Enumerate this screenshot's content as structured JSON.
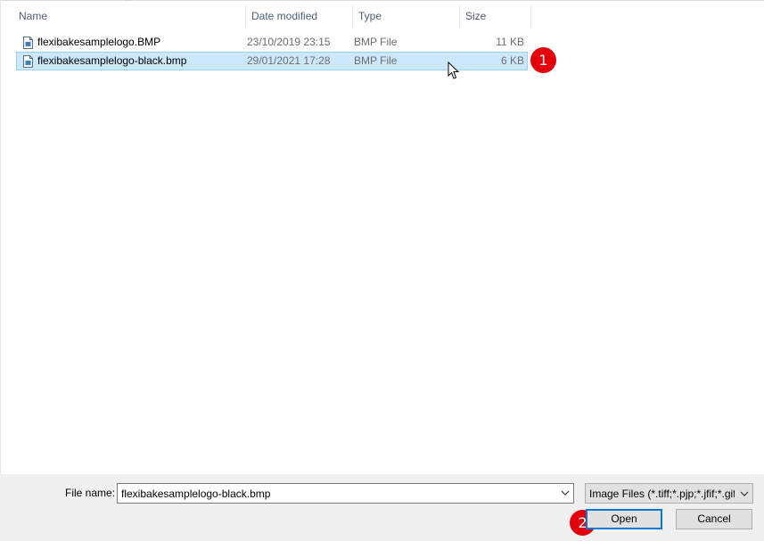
{
  "columns": {
    "name": "Name",
    "date": "Date modified",
    "type": "Type",
    "size": "Size"
  },
  "files": [
    {
      "name": "flexibakesamplelogo.BMP",
      "date": "23/10/2019 23:15",
      "type": "BMP File",
      "size": "11 KB",
      "selected": false
    },
    {
      "name": "flexibakesamplelogo-black.bmp",
      "date": "29/01/2021 17:28",
      "type": "BMP File",
      "size": "6 KB",
      "selected": true
    }
  ],
  "annotations": {
    "step1": "1",
    "step2": "2"
  },
  "footer": {
    "file_name_label": "File name:",
    "file_name_value": "flexibakesamplelogo-black.bmp",
    "filter_value": "Image Files (*.tiff;*.pjp;*.jfif;*.gif;*.svg;*.bmp)",
    "open_label": "Open",
    "cancel_label": "Cancel"
  },
  "colors": {
    "selection": "#cce8ff",
    "selection_border": "#99d1ff",
    "badge": "#e3000b",
    "accent": "#0078d7"
  },
  "icons": {
    "file": "bmp-file-icon",
    "sort": "sort-up-icon",
    "dropdown": "chevron-down-icon",
    "cursor": "mouse-pointer-icon"
  }
}
